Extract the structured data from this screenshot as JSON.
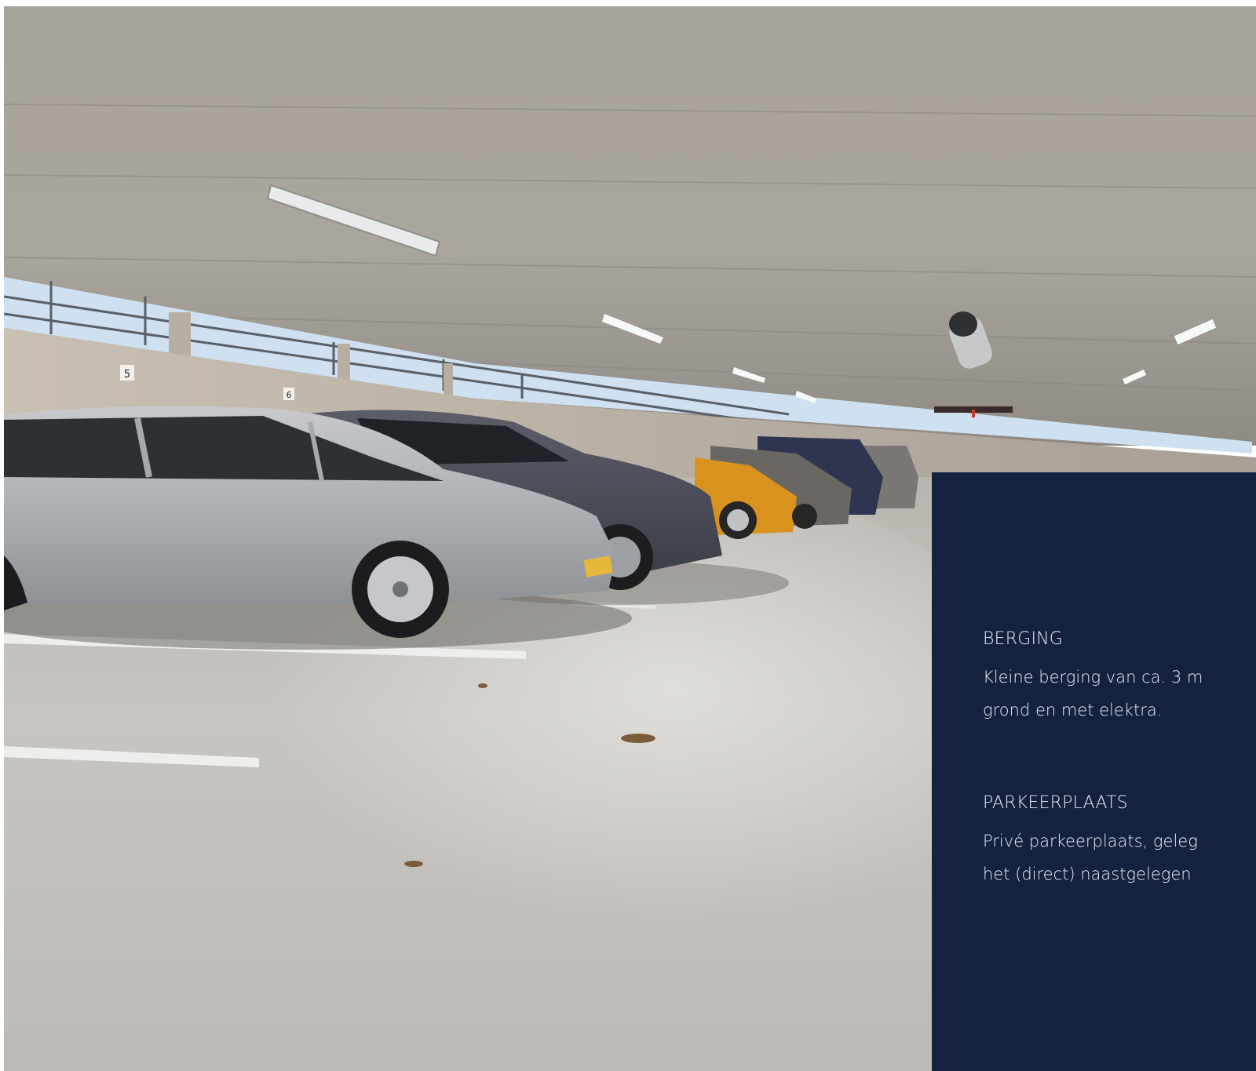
{
  "photo": {
    "subject": "photo-parking-garage",
    "colors": {
      "ceiling": "#a7a29a",
      "floor": "#c9c6c1",
      "wall": "#bdb4a8",
      "light_sky": "#cfe0f0"
    },
    "bay_numbers": [
      "5",
      "6"
    ]
  },
  "panel": {
    "background": "#14213f",
    "sections": [
      {
        "title": "BERGING",
        "lines": [
          "Kleine berging van ca. 3 m",
          "grond en met elektra."
        ]
      },
      {
        "title": "PARKEERPLAATS",
        "lines": [
          "Privé parkeerplaats, geleg",
          "het (direct) naastgelegen"
        ]
      }
    ]
  }
}
